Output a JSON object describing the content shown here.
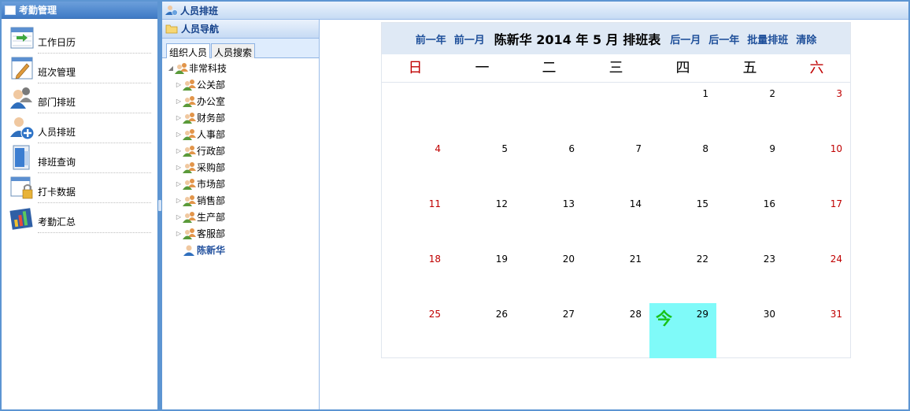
{
  "left_panel": {
    "title": "考勤管理",
    "items": [
      {
        "label": "工作日历",
        "icon": "calendar-arrow-icon"
      },
      {
        "label": "班次管理",
        "icon": "pencil-document-icon"
      },
      {
        "label": "部门排班",
        "icon": "users-group-icon"
      },
      {
        "label": "人员排班",
        "icon": "user-add-icon"
      },
      {
        "label": "排班查询",
        "icon": "search-document-icon"
      },
      {
        "label": "打卡数据",
        "icon": "lock-window-icon"
      },
      {
        "label": "考勤汇总",
        "icon": "bar-chart-icon"
      }
    ]
  },
  "main_panel": {
    "title": "人员排班"
  },
  "nav_panel": {
    "title": "人员导航",
    "tabs": [
      "组织人员",
      "人员搜索"
    ],
    "tree": {
      "root": "非常科技",
      "departments": [
        "公关部",
        "办公室",
        "财务部",
        "人事部",
        "行政部",
        "采购部",
        "市场部",
        "销售部",
        "生产部",
        "客服部"
      ],
      "user": "陈新华"
    }
  },
  "calendar": {
    "toolbar": {
      "prev_year": "前一年",
      "prev_month": "前一月",
      "title": "陈新华 2014 年 5 月 排班表",
      "next_month": "后一月",
      "next_year": "后一年",
      "batch": "批量排班",
      "clear": "清除"
    },
    "weekdays": [
      "日",
      "一",
      "二",
      "三",
      "四",
      "五",
      "六"
    ],
    "first_weekday_index": 4,
    "days_in_month": 31,
    "today": 29,
    "today_label": "今",
    "colors": {
      "weekend": "#c00000",
      "today_bg": "#7ffaf9",
      "today_mark": "#18c218",
      "link": "#1e4f9a"
    }
  }
}
